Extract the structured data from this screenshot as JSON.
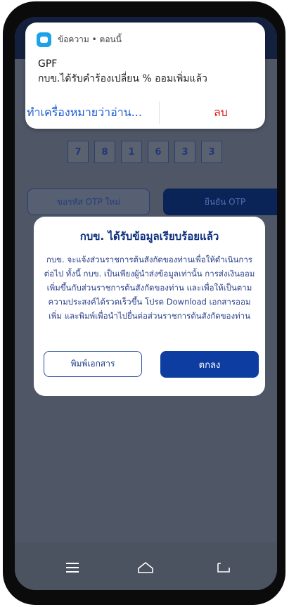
{
  "notification": {
    "source": "ข้อความ • ตอนนี้",
    "title": "GPF",
    "body": "กบข.ได้รับคำร้องเปลี่ยน % ออมเพิ่มแล้ว",
    "action_mark_read": "ทำเครื่องหมายว่าอ่าน...",
    "action_delete": "ลบ"
  },
  "otp": {
    "digits": [
      "7",
      "8",
      "1",
      "6",
      "3",
      "3"
    ],
    "resend_label": "ขอรหัส OTP ใหม่",
    "confirm_label": "ยืนยัน OTP"
  },
  "dialog": {
    "title": "กบข. ได้รับข้อมูลเรียบร้อยแล้ว",
    "body": "กบข. จะแจ้งส่วนราชการต้นสังกัดของท่านเพื่อให้ดำเนินการต่อไป ทั้งนี้ กบข. เป็นเพียงผู้นำส่งข้อมูลเท่านั้น การส่งเงินออมเพิ่มขึ้นกับส่วนราชการต้นสังกัดของท่าน และเพื่อให้เป็นตามความประสงค์ได้รวดเร็วขึ้น โปรด Download เอกสารออมเพิ่ม และพิมพ์เพื่อนำไปยื่นต่อส่วนราชการต้นสังกัดของท่าน",
    "print_label": "พิมพ์เอกสาร",
    "ok_label": "ตกลง"
  },
  "navbar": {
    "icons": [
      "menu-icon",
      "home-icon",
      "back-icon"
    ]
  },
  "colors": {
    "app_icon": "#1aa3e8",
    "delete_action": "#e02020",
    "primary": "#0d3da0"
  }
}
